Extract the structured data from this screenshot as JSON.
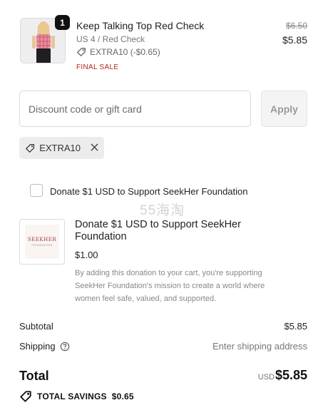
{
  "product": {
    "quantity": "1",
    "title": "Keep Talking Top Red Check",
    "variant": "US 4 / Red Check",
    "discount_line": "EXTRA10 (-$0.65)",
    "final_sale": "FINAL SALE",
    "original_price": "$6.50",
    "price": "$5.85"
  },
  "discount": {
    "placeholder": "Discount code or gift card",
    "apply_label": "Apply",
    "applied_code": "EXTRA10"
  },
  "donation_checkbox": {
    "label": "Donate $1 USD to Support SeekHer Foundation",
    "checked": false
  },
  "watermark": "55海淘",
  "donation_item": {
    "logo_text": "SEEKHER",
    "logo_subtext": "FOUNDATION",
    "title": "Donate $1 USD to Support SeekHer Foundation",
    "price": "$1.00",
    "description": "By adding this donation to your cart, you're supporting SeekHer Foundation's mission to create a world where women feel safe, valued, and supported."
  },
  "summary": {
    "subtotal_label": "Subtotal",
    "subtotal_value": "$5.85",
    "shipping_label": "Shipping",
    "shipping_value": "Enter shipping address",
    "total_label": "Total",
    "currency": "USD",
    "total_value": "$5.85",
    "savings_label": "TOTAL SAVINGS",
    "savings_value": "$0.65"
  },
  "colors": {
    "final_sale": "#b3261e",
    "badge": "#111111",
    "chip_bg": "#ececec"
  }
}
